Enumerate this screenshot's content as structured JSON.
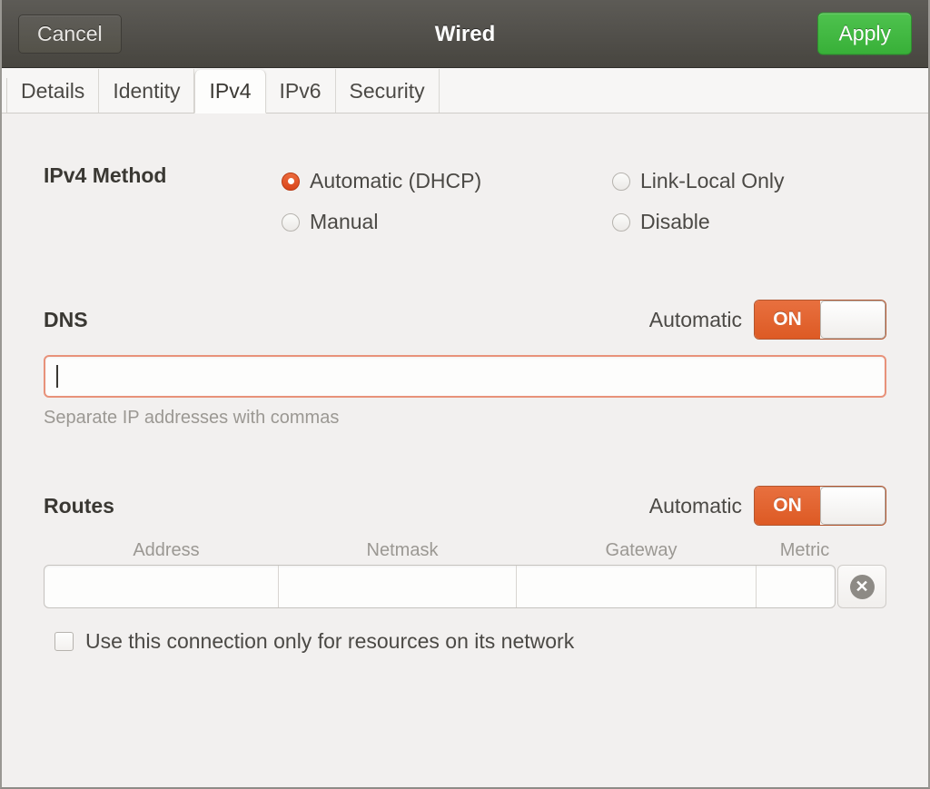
{
  "titlebar": {
    "cancel_label": "Cancel",
    "title": "Wired",
    "apply_label": "Apply",
    "apply_color": "#3cb83c",
    "background_color": "#514f4a"
  },
  "tabs": [
    {
      "label": "Details",
      "active": false
    },
    {
      "label": "Identity",
      "active": false
    },
    {
      "label": "IPv4",
      "active": true
    },
    {
      "label": "IPv6",
      "active": false
    },
    {
      "label": "Security",
      "active": false
    }
  ],
  "accent_color": "#e95420",
  "ipv4_method": {
    "label": "IPv4 Method",
    "options": [
      {
        "label": "Automatic (DHCP)",
        "selected": true
      },
      {
        "label": "Manual",
        "selected": false
      },
      {
        "label": "Link-Local Only",
        "selected": false
      },
      {
        "label": "Disable",
        "selected": false
      }
    ]
  },
  "dns": {
    "label": "DNS",
    "automatic_label": "Automatic",
    "switch_state": "ON",
    "input_value": "",
    "hint": "Separate IP addresses with commas"
  },
  "routes": {
    "label": "Routes",
    "automatic_label": "Automatic",
    "switch_state": "ON",
    "columns": [
      "Address",
      "Netmask",
      "Gateway",
      "Metric"
    ],
    "rows": [
      {
        "address": "",
        "netmask": "",
        "gateway": "",
        "metric": ""
      }
    ],
    "delete_icon": "close-circle-icon"
  },
  "restrict_checkbox": {
    "label": "Use this connection only for resources on its network",
    "checked": false
  }
}
